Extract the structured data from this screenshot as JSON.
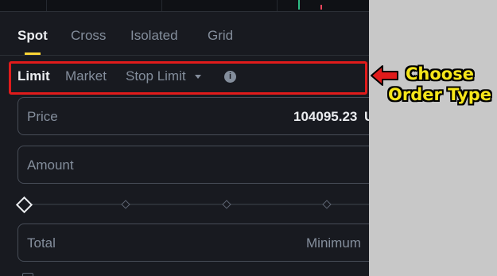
{
  "tabs": {
    "spot": "Spot",
    "cross": "Cross",
    "isolated": "Isolated",
    "grid": "Grid"
  },
  "order_types": {
    "limit": "Limit",
    "market": "Market",
    "stop_limit": "Stop Limit",
    "info_glyph": "i"
  },
  "price": {
    "label": "Price",
    "value": "104095.23",
    "unit": "U"
  },
  "amount": {
    "label": "Amount"
  },
  "total": {
    "label": "Total",
    "hint": "Minimum"
  },
  "annotation": {
    "line1": "Choose",
    "line2": "Order Type"
  },
  "colors": {
    "accent": "#fcd535",
    "highlight": "#e01b1b",
    "callout": "#f6e61a",
    "panel_bg": "#181a20"
  },
  "icons": {
    "dropdown": "caret-down-icon",
    "info": "info-icon",
    "arrow": "arrow-left-icon"
  }
}
